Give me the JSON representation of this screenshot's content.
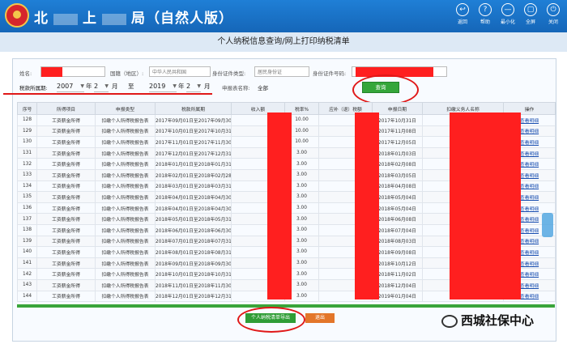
{
  "header": {
    "brand_left": "北",
    "brand_mid": "上",
    "brand_right": "局（自然人版）",
    "tools": [
      {
        "icon": "back-icon",
        "glyph": "↩",
        "label": "返回"
      },
      {
        "icon": "help-icon",
        "glyph": "?",
        "label": "帮助"
      },
      {
        "icon": "minimize-icon",
        "glyph": "—",
        "label": "最小化"
      },
      {
        "icon": "fullscreen-icon",
        "glyph": "▢",
        "label": "全屏"
      },
      {
        "icon": "close-icon",
        "glyph": "⏻",
        "label": "关闭"
      }
    ]
  },
  "page_title": "个人纳税信息查询/网上打印纳税清单",
  "form": {
    "name_label": "姓名:",
    "nationality_label": "国籍（地区）:",
    "nationality_value": "中华人民共和国",
    "id_type_label": "身份证件类型:",
    "id_type_value": "居民身份证",
    "id_no_label": "身份证件号码:",
    "period_label": "税款所属期:",
    "from_year": "2007",
    "year_unit": "年",
    "from_month": "2",
    "month_unit": "月",
    "to_label": "至",
    "to_year": "2019",
    "to_month": "2",
    "report_name_label": "申报表名称:",
    "report_name_value": "全部",
    "query_button": "查询"
  },
  "table": {
    "headers": [
      "序号",
      "所得项目",
      "申报类型",
      "税款所属期",
      "收入额",
      "税率%",
      "应补（退）税额",
      "申报日期",
      "扣缴义务人名称",
      "操作"
    ],
    "rows": [
      [
        "128",
        "工资薪金所得",
        "扣缴个人所得税报告表",
        "2017年09月01日至2017年09月30",
        "",
        "10.00",
        "",
        "2017年10月31日",
        "",
        "查看明细"
      ],
      [
        "129",
        "工资薪金所得",
        "扣缴个人所得税报告表",
        "2017年10月01日至2017年10月31",
        "",
        "10.00",
        "",
        "2017年11月08日",
        "",
        "查看明细"
      ],
      [
        "130",
        "工资薪金所得",
        "扣缴个人所得税报告表",
        "2017年11月01日至2017年11月30",
        "",
        "10.00",
        "",
        "2017年12月05日",
        "",
        "查看明细"
      ],
      [
        "131",
        "工资薪金所得",
        "扣缴个人所得税报告表",
        "2017年12月01日至2017年12月31",
        "",
        "3.00",
        "",
        "2018年01月03日",
        "",
        "查看明细"
      ],
      [
        "132",
        "工资薪金所得",
        "扣缴个人所得税报告表",
        "2018年01月01日至2018年01月31",
        "",
        "3.00",
        "",
        "2018年02月08日",
        "",
        "查看明细"
      ],
      [
        "133",
        "工资薪金所得",
        "扣缴个人所得税报告表",
        "2018年02月01日至2018年02月28",
        "",
        "3.00",
        "",
        "2018年03月05日",
        "",
        "查看明细"
      ],
      [
        "134",
        "工资薪金所得",
        "扣缴个人所得税报告表",
        "2018年03月01日至2018年03月31",
        "",
        "3.00",
        "",
        "2018年04月08日",
        "",
        "查看明细"
      ],
      [
        "135",
        "工资薪金所得",
        "扣缴个人所得税报告表",
        "2018年04月01日至2018年04月30",
        "",
        "3.00",
        "",
        "2018年05月04日",
        "",
        "查看明细"
      ],
      [
        "136",
        "工资薪金所得",
        "扣缴个人所得税报告表",
        "2018年04月01日至2018年04月30",
        "",
        "3.00",
        "",
        "2018年05月04日",
        "",
        "查看明细"
      ],
      [
        "137",
        "工资薪金所得",
        "扣缴个人所得税报告表",
        "2018年05月01日至2018年05月31",
        "",
        "3.00",
        "",
        "2018年06月08日",
        "",
        "查看明细"
      ],
      [
        "138",
        "工资薪金所得",
        "扣缴个人所得税报告表",
        "2018年06月01日至2018年06月30",
        "",
        "3.00",
        "",
        "2018年07月04日",
        "",
        "查看明细"
      ],
      [
        "139",
        "工资薪金所得",
        "扣缴个人所得税报告表",
        "2018年07月01日至2018年07月31",
        "",
        "3.00",
        "",
        "2018年08月03日",
        "",
        "查看明细"
      ],
      [
        "140",
        "工资薪金所得",
        "扣缴个人所得税报告表",
        "2018年08月01日至2018年08月31",
        "",
        "3.00",
        "",
        "2018年09月08日",
        "",
        "查看明细"
      ],
      [
        "141",
        "工资薪金所得",
        "扣缴个人所得税报告表",
        "2018年09月01日至2018年09月30",
        "",
        "3.00",
        "",
        "2018年10月12日",
        "",
        "查看明细"
      ],
      [
        "142",
        "工资薪金所得",
        "扣缴个人所得税报告表",
        "2018年10月01日至2018年10月31",
        "",
        "3.00",
        "",
        "2018年11月02日",
        "",
        "查看明细"
      ],
      [
        "143",
        "工资薪金所得",
        "扣缴个人所得税报告表",
        "2018年11月01日至2018年11月30",
        "",
        "3.00",
        "",
        "2018年12月04日",
        "",
        "查看明细"
      ],
      [
        "144",
        "工资薪金所得",
        "扣缴个人所得税报告表",
        "2018年12月01日至2018年12月31",
        "",
        "3.00",
        "",
        "2019年01月04日",
        "",
        "查看明细"
      ]
    ]
  },
  "footer": {
    "export_button": "个人纳税清单导出",
    "exit_button": "退出"
  },
  "watermark": "西城社保中心"
}
